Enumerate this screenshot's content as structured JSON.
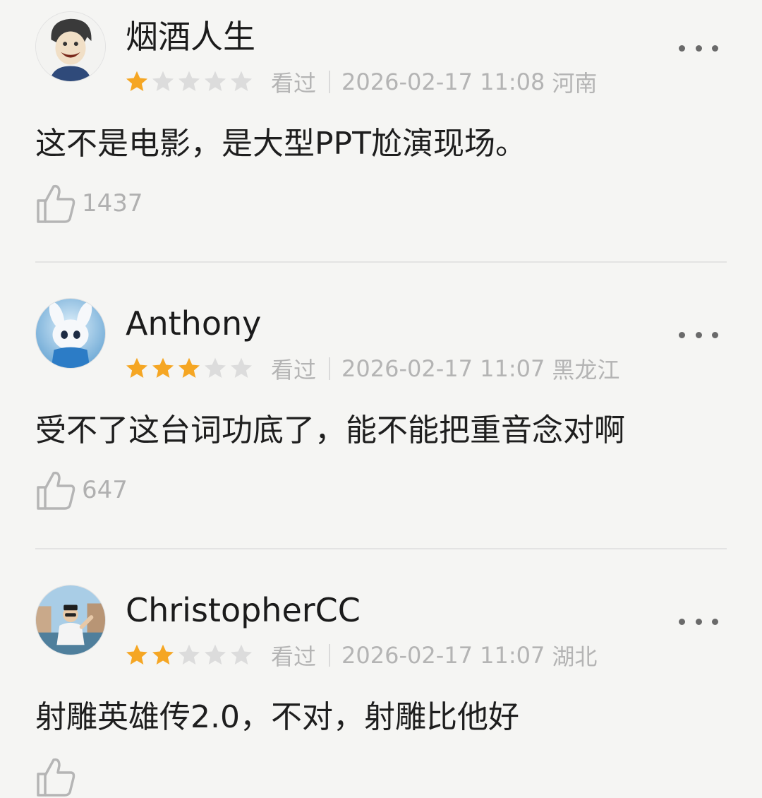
{
  "colors": {
    "background": "#f5f5f3",
    "star_filled": "#f5a623",
    "star_empty": "#dcdcdc",
    "meta_text": "#b4b4b4"
  },
  "icons": {
    "more": "ellipsis-icon",
    "like": "thumbs-up-icon",
    "star": "star-icon"
  },
  "reviews": [
    {
      "username": "烟酒人生",
      "rating": 1,
      "rating_max": 5,
      "watched_label": "看过",
      "datetime": "2026-02-17 11:08",
      "location": "河南",
      "content": "这不是电影，是大型PPT尬演现场。",
      "likes": "1437"
    },
    {
      "username": "Anthony",
      "rating": 3,
      "rating_max": 5,
      "watched_label": "看过",
      "datetime": "2026-02-17 11:07",
      "location": "黑龙江",
      "content": "受不了这台词功底了，能不能把重音念对啊",
      "likes": "647"
    },
    {
      "username": "ChristopherCC",
      "rating": 2,
      "rating_max": 5,
      "watched_label": "看过",
      "datetime": "2026-02-17 11:07",
      "location": "湖北",
      "content": "射雕英雄传2.0，不对，射雕比他好",
      "likes": ""
    }
  ]
}
